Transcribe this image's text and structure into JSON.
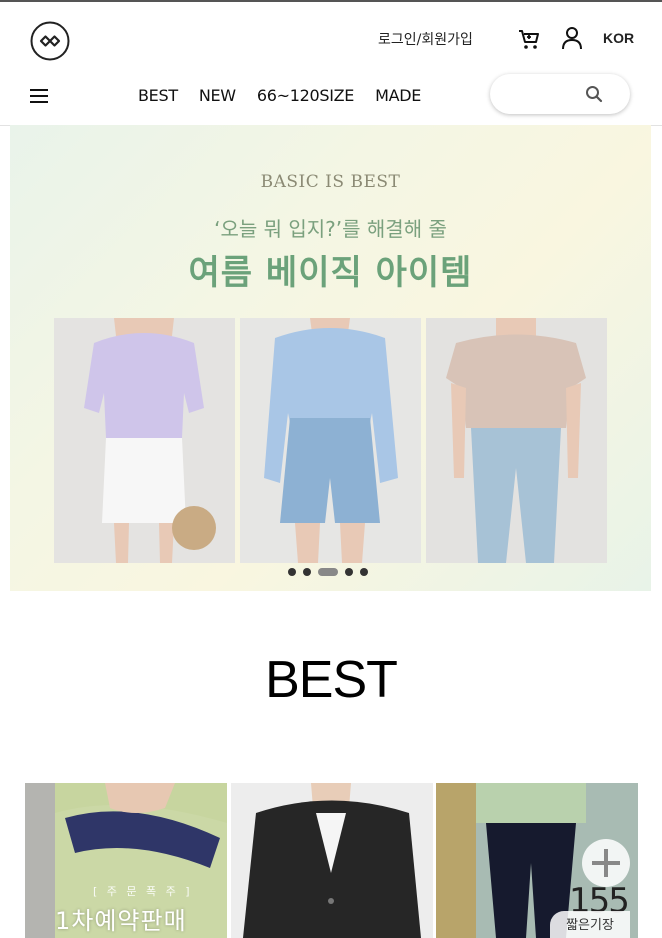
{
  "header": {
    "logo_alt": "logo",
    "login_label": "로그인/회원가입",
    "lang_label": "KOR",
    "nav": [
      "BEST",
      "NEW",
      "66~120SIZE",
      "MADE"
    ],
    "search_placeholder": ""
  },
  "banner": {
    "eyebrow": "BASIC IS BEST",
    "subtitle": "‘오늘 뭐 입지?’를 해결해 줄",
    "title": "여름 베이직 아이템",
    "slide_count": 5,
    "active_slide": 3
  },
  "best": {
    "title": "BEST",
    "products": [
      {
        "badge_small": "[ 주 문 폭 주 ]",
        "badge_big": "1차예약판매"
      },
      {},
      {
        "length_num": "155",
        "length_label": "짧은기장"
      }
    ]
  },
  "colors": {
    "banner_title": "#6ba27a",
    "text": "#111111"
  }
}
